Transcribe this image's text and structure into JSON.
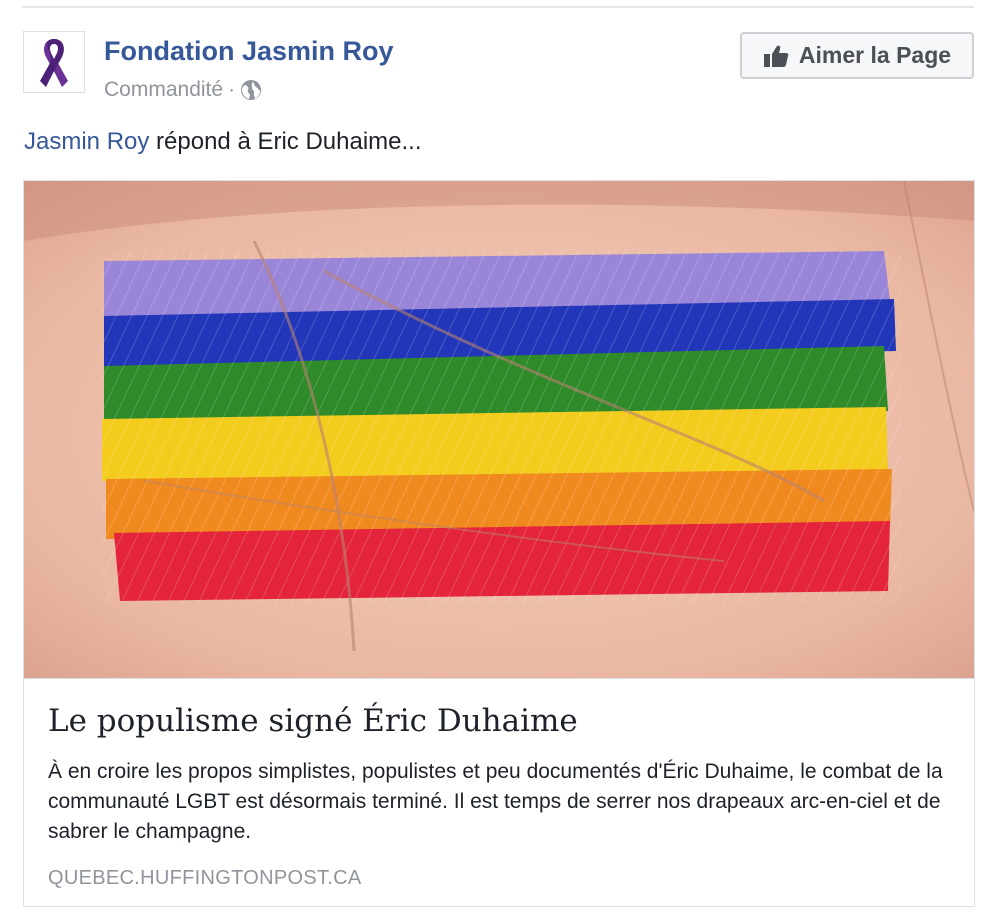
{
  "post": {
    "page_name": "Fondation Jasmin Roy",
    "sponsored_label": "Commandité",
    "separator": "·",
    "privacy_icon": "globe-icon",
    "like_button_label": "Aimer la Page",
    "like_icon": "thumbs-up-icon",
    "avatar_icon": "purple-ribbon-icon",
    "message": {
      "mention": "Jasmin Roy",
      "text": " répond à Eric Duhaime..."
    }
  },
  "link_card": {
    "image_description_icon": "rainbow-flag-on-palm-image",
    "title": "Le populisme signé Éric Duhaime",
    "description": "À en croire les propos simplistes, populistes et peu documentés d'Éric Duhaime, le combat de la communauté LGBT est désormais terminé. Il est temps de serrer nos drapeaux arc-en-ciel et de sabrer le champagne.",
    "domain": "QUEBEC.HUFFINGTONPOST.CA"
  },
  "colors": {
    "link_blue": "#365899",
    "meta_gray": "#90949c",
    "ribbon_purple": "#5b2a86"
  }
}
